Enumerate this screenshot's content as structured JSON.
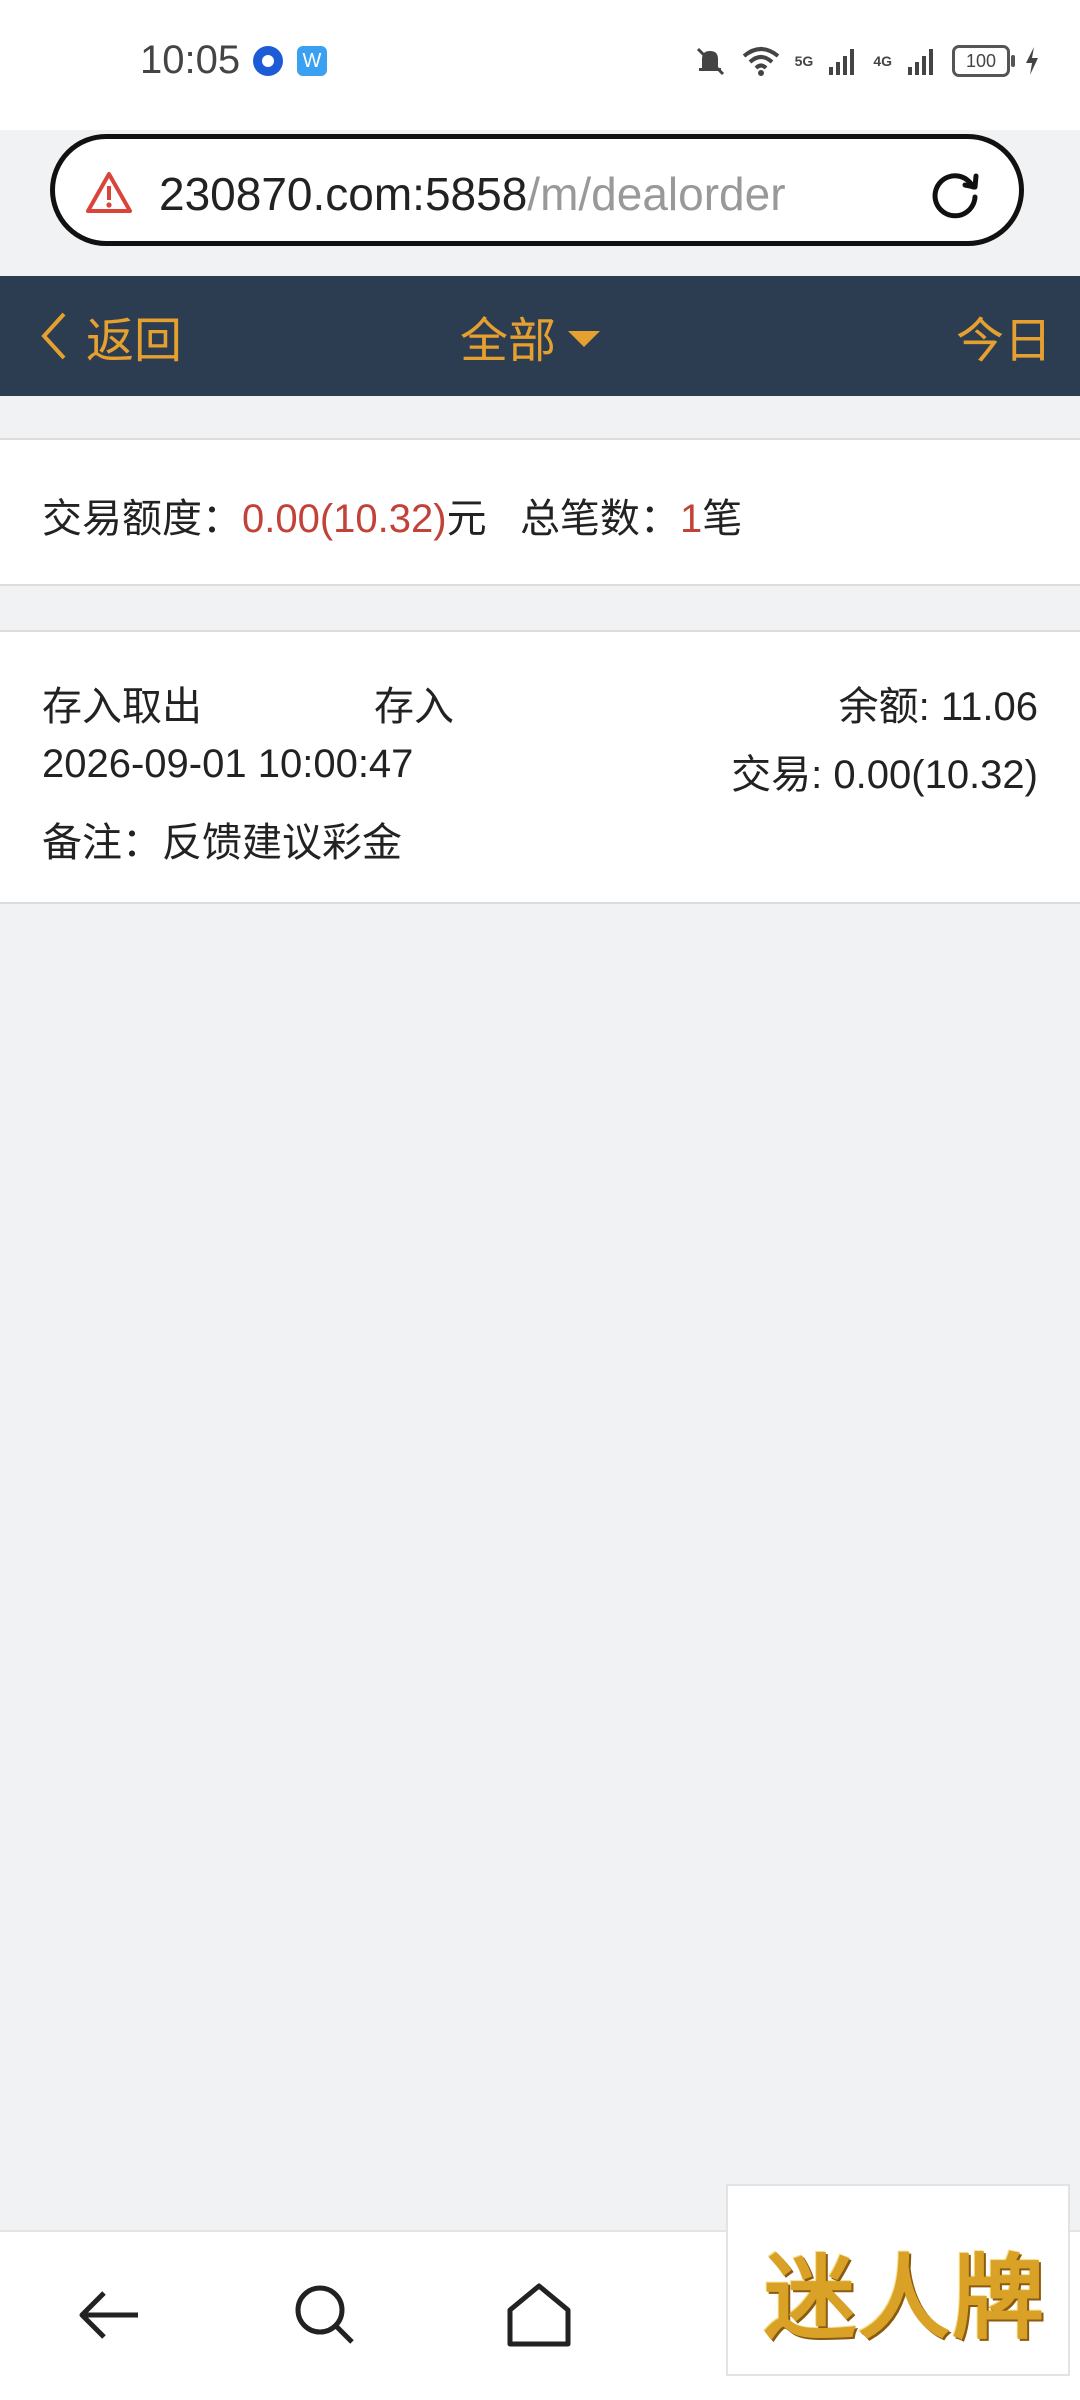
{
  "status_bar": {
    "time": "10:05",
    "app_icon_text": "W",
    "network_5g": "5G",
    "network_4g": "4G",
    "battery": "100"
  },
  "address_bar": {
    "host": "230870.com:5858",
    "path": "/m/dealorder"
  },
  "nav": {
    "back_label": "返回",
    "title": "全部",
    "right_label": "今日"
  },
  "summary": {
    "amount_label": "交易额度：",
    "amount_value": "0.00(10.32)",
    "amount_unit": "元",
    "count_label": "总笔数：",
    "count_value": "1",
    "count_unit": "笔"
  },
  "records": [
    {
      "category": "存入取出",
      "type": "存入",
      "balance": "余额: 11.06",
      "time": "2026-09-01 10:00:47",
      "trade": "交易: 0.00(10.32)",
      "note": "备注：反馈建议彩金"
    }
  ],
  "ad": {
    "text": "迷人牌"
  },
  "colors": {
    "nav_bg": "#2c3d52",
    "accent": "#e5a02f",
    "highlight": "#c2423a",
    "warning": "#d9453b"
  }
}
